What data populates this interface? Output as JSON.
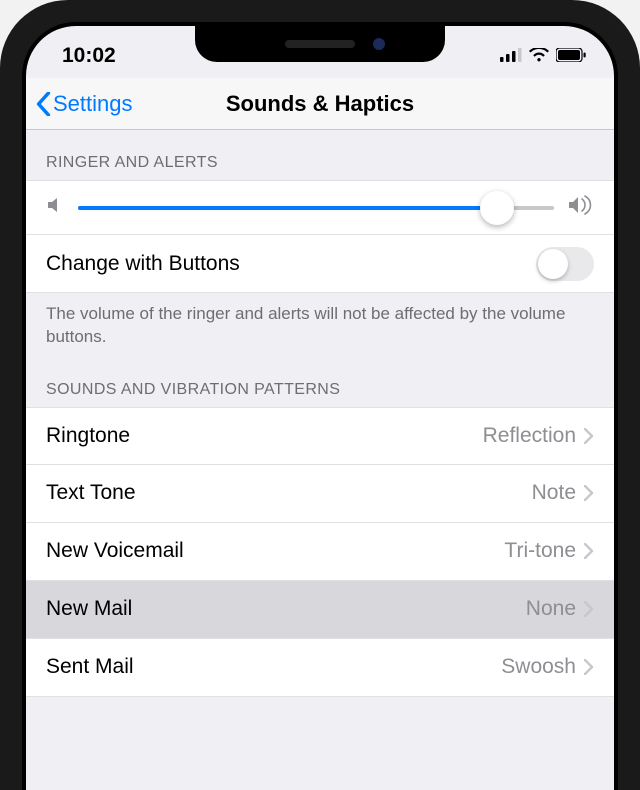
{
  "status": {
    "time": "10:02"
  },
  "nav": {
    "back": "Settings",
    "title": "Sounds & Haptics"
  },
  "ringer": {
    "header": "RINGER AND ALERTS",
    "sliderPercent": 88,
    "changeWithButtonsLabel": "Change with Buttons",
    "changeWithButtonsOn": false,
    "footer": "The volume of the ringer and alerts will not be affected by the volume buttons."
  },
  "patterns": {
    "header": "SOUNDS AND VIBRATION PATTERNS",
    "items": [
      {
        "label": "Ringtone",
        "value": "Reflection",
        "selected": false
      },
      {
        "label": "Text Tone",
        "value": "Note",
        "selected": false
      },
      {
        "label": "New Voicemail",
        "value": "Tri-tone",
        "selected": false
      },
      {
        "label": "New Mail",
        "value": "None",
        "selected": true
      },
      {
        "label": "Sent Mail",
        "value": "Swoosh",
        "selected": false
      }
    ]
  },
  "colors": {
    "link": "#007aff",
    "accent": "#007aff",
    "secondaryText": "#8e8e93"
  }
}
